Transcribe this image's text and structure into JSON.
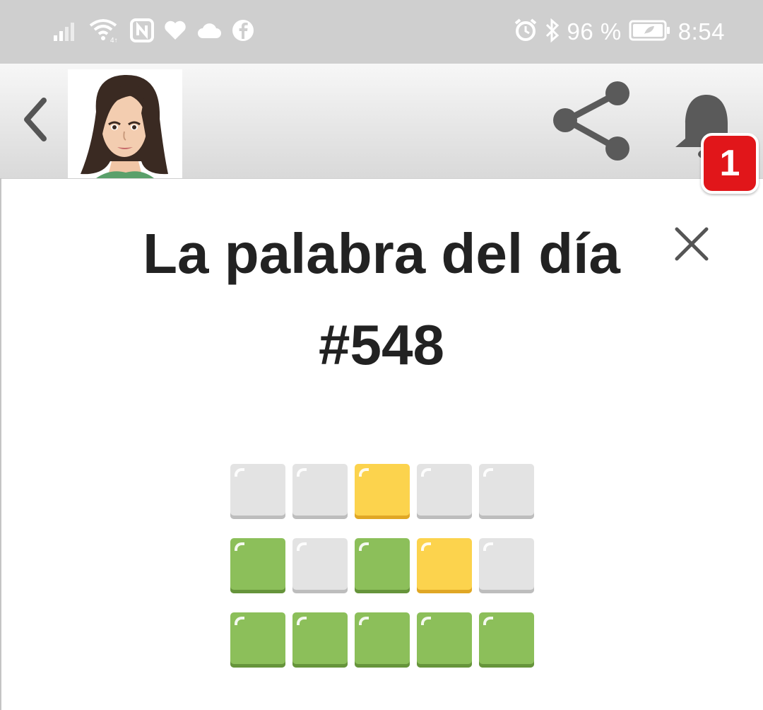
{
  "status_bar": {
    "battery": "96 %",
    "time": "8:54",
    "icons": [
      "signal-icon",
      "wifi-icon",
      "nfc-icon",
      "heart-icon",
      "cloud-icon",
      "facebook-icon",
      "alarm-icon",
      "bluetooth-icon",
      "battery-icon"
    ]
  },
  "header": {
    "icons": [
      "back-icon",
      "avatar",
      "share-icon",
      "bell-icon"
    ],
    "notification_count": "1"
  },
  "main": {
    "title": "La palabra del día",
    "number": "#548",
    "close_icon": "close-icon"
  },
  "board": {
    "rows": [
      [
        "gray",
        "gray",
        "yellow",
        "gray",
        "gray"
      ],
      [
        "green",
        "gray",
        "green",
        "yellow",
        "gray"
      ],
      [
        "green",
        "green",
        "green",
        "green",
        "green"
      ]
    ],
    "colors": {
      "gray": "#e3e3e3",
      "yellow": "#fcd34d",
      "green": "#8cbf5a"
    }
  }
}
